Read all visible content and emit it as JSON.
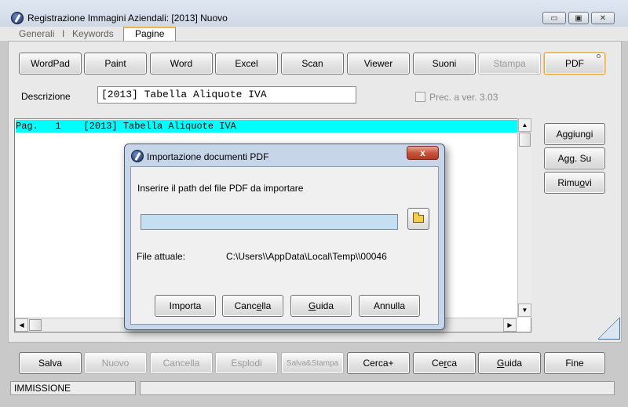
{
  "window": {
    "title": "Registrazione Immagini Aziendali:  [2013] Nuovo",
    "minimize": "▭",
    "maximize": "▣",
    "close": "✕"
  },
  "tabs": [
    {
      "label": "Generali"
    },
    {
      "label": "I"
    },
    {
      "label": "Keywords"
    },
    {
      "label": "Pagine"
    }
  ],
  "toolbar": {
    "buttons": [
      "WordPad",
      "Paint",
      "Word",
      "Excel",
      "Scan",
      "Viewer",
      "Suoni",
      "Stampa",
      "PDF"
    ]
  },
  "description": {
    "label": "Descrizione",
    "value": "[2013] Tabella Aliquote IVA",
    "checkbox_label": "Prec. a ver. 3.03"
  },
  "pages_list": {
    "rows": [
      "Pag.   1    [2013] Tabella Aliquote IVA"
    ]
  },
  "side_buttons": {
    "add_prefix": "A",
    "add_ul": "g",
    "add_suffix": "giungi",
    "add_above": "Agg. Su",
    "remove_prefix": "Rimu",
    "remove_ul": "o",
    "remove_suffix": "vi"
  },
  "dialog": {
    "title": "Importazione documenti PDF",
    "close": "x",
    "prompt": "Inserire il path del file PDF da importare",
    "path_value": "",
    "current_label": "File attuale:",
    "current_value": "C:\\Users\\\\AppData\\Local\\Temp\\\\00046",
    "buttons": {
      "import": "Importa",
      "cancel_prefix": "Canc",
      "cancel_ul": "e",
      "cancel_suffix": "lla",
      "guide_ul": "G",
      "guide_suffix": "uida",
      "abort": "Annulla"
    }
  },
  "bottom_bar": {
    "save": "Salva",
    "new": "Nuovo",
    "delete": "Cancella",
    "explode": "Esplodi",
    "save_print": "Salva&Stampa",
    "search_plus": "Cerca+",
    "search_prefix": "Ce",
    "search_ul": "r",
    "search_suffix": "ca",
    "guide_ul": "G",
    "guide_suffix": "uida",
    "end": "Fine"
  },
  "status": {
    "mode": "IMMISSIONE",
    "message": ""
  }
}
